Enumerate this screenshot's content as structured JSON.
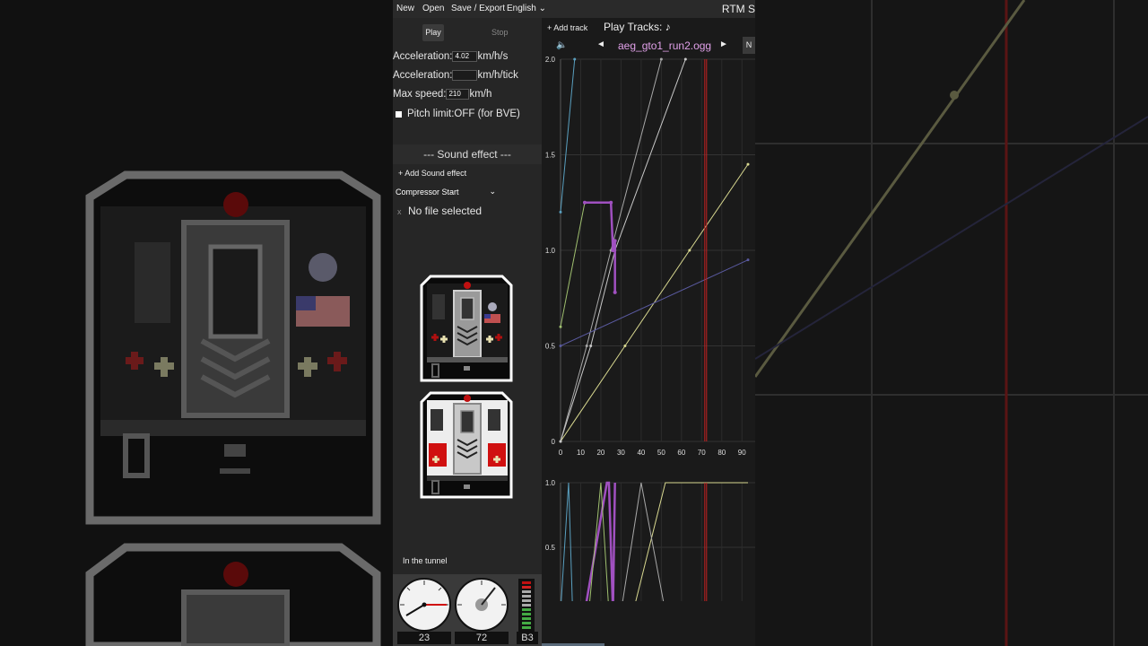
{
  "menu": {
    "new": "New",
    "open": "Open",
    "save_export": "Save / Export",
    "language": "English",
    "language_caret": "⌄",
    "app_title": "RTM S"
  },
  "controls": {
    "play": "Play",
    "stop": "Stop",
    "accel1_label": "Acceleration:",
    "accel1_value": "4.02",
    "accel1_unit": "km/h/s",
    "accel2_label": "Acceleration:",
    "accel2_value": "",
    "accel2_unit": "km/h/tick",
    "maxspeed_label": "Max speed:",
    "maxspeed_value": "210",
    "maxspeed_unit": "km/h",
    "pitch_label": "Pitch limit:OFF (for BVE)"
  },
  "sound_effect": {
    "header": "---   Sound effect   ---",
    "add": "+ Add Sound effect",
    "selected": "Compressor Start",
    "remove": "x",
    "file": "No file selected"
  },
  "status": {
    "tunnel": "In the tunnel"
  },
  "gauges": {
    "speed": "23",
    "rpm": "72",
    "notch": "B3"
  },
  "tracks": {
    "add": "+ Add track",
    "play_tracks": "Play Tracks: ♪",
    "prev": "◄",
    "next": "►",
    "current": "aeg_gto1_run2.ogg",
    "n_button": "N",
    "volume_icon": "speaker-icon"
  },
  "chart_data": [
    {
      "type": "line",
      "title": "",
      "xlabel": "",
      "ylabel": "",
      "x_ticks": [
        "0",
        "10",
        "20",
        "30",
        "40",
        "50",
        "60",
        "70",
        "80",
        "90"
      ],
      "y_ticks": [
        "0",
        "0.5",
        "1.0",
        "1.5",
        "2.0"
      ],
      "xlim": [
        0,
        93
      ],
      "ylim": [
        0,
        2.0
      ],
      "grid": true,
      "series": [
        {
          "color": "#d8d890",
          "points": [
            [
              0,
              0
            ],
            [
              32,
              0.5
            ],
            [
              64,
              1.0
            ],
            [
              93,
              1.45
            ]
          ]
        },
        {
          "color": "#a8a8a8",
          "points": [
            [
              0,
              0
            ],
            [
              13,
              0.5
            ],
            [
              25,
              1.0
            ],
            [
              50,
              2.0
            ]
          ]
        },
        {
          "color": "#c8c8c8",
          "points": [
            [
              0,
              0
            ],
            [
              15,
              0.5
            ],
            [
              27,
              1.0
            ],
            [
              62,
              2.0
            ]
          ]
        },
        {
          "color": "#5aa0c0",
          "points": [
            [
              0,
              1.2
            ],
            [
              7,
              2.0
            ]
          ]
        },
        {
          "color": "#a0c070",
          "points": [
            [
              0,
              0.6
            ],
            [
              12,
              1.25
            ]
          ]
        },
        {
          "color": "#a050c0",
          "points": [
            [
              12,
              1.25
            ],
            [
              25,
              1.25
            ],
            [
              26,
              1.0
            ],
            [
              27,
              1.05
            ],
            [
              27,
              0.78
            ]
          ]
        },
        {
          "color": "#5a5aa0",
          "points": [
            [
              0,
              0.5
            ],
            [
              93,
              0.95
            ]
          ]
        }
      ],
      "marker": {
        "color": "#c02020",
        "x": 72
      }
    },
    {
      "type": "line",
      "title": "",
      "x_ticks": [],
      "y_ticks": [
        "0",
        "0.5",
        "1.0"
      ],
      "xlim": [
        0,
        93
      ],
      "ylim": [
        0,
        1.0
      ],
      "grid": true,
      "series": [
        {
          "color": "#d8d890",
          "points": [
            [
              36,
              0
            ],
            [
              52,
              1.0
            ],
            [
              93,
              1.0
            ]
          ]
        },
        {
          "color": "#a050c0",
          "points": [
            [
              12,
              0
            ],
            [
              23,
              1.0
            ],
            [
              24,
              1.0
            ],
            [
              26,
              0
            ],
            [
              27,
              1.0
            ]
          ]
        },
        {
          "color": "#a0c070",
          "points": [
            [
              14,
              0
            ],
            [
              20,
              1.0
            ],
            [
              24,
              0
            ]
          ]
        },
        {
          "color": "#5aa0c0",
          "points": [
            [
              0,
              0
            ],
            [
              4,
              1.0
            ],
            [
              6,
              0
            ]
          ]
        },
        {
          "color": "#a8a8a8",
          "points": [
            [
              30,
              0
            ],
            [
              40,
              1.0
            ],
            [
              52,
              0
            ]
          ]
        }
      ],
      "marker": {
        "color": "#c02020",
        "x": 72
      }
    }
  ]
}
